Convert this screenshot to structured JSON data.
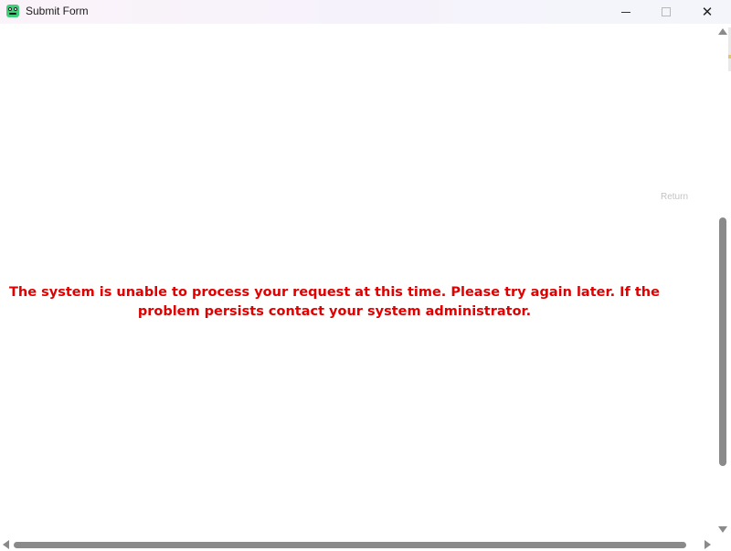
{
  "window": {
    "title": "Submit Form",
    "controls": {
      "minimize_icon": "minimize-icon",
      "maximize_icon": "maximize-icon",
      "close_glyph": "✕"
    }
  },
  "content": {
    "return_link": "Return",
    "error_message": "The system is unable to process your request at this time. Please try again later. If the problem persists contact your system administrator."
  },
  "colors": {
    "error_text": "#e00000",
    "return_link": "#c3c3c3",
    "scrollbar": "#8a8a8a",
    "app_icon": "#3fcf7b"
  }
}
